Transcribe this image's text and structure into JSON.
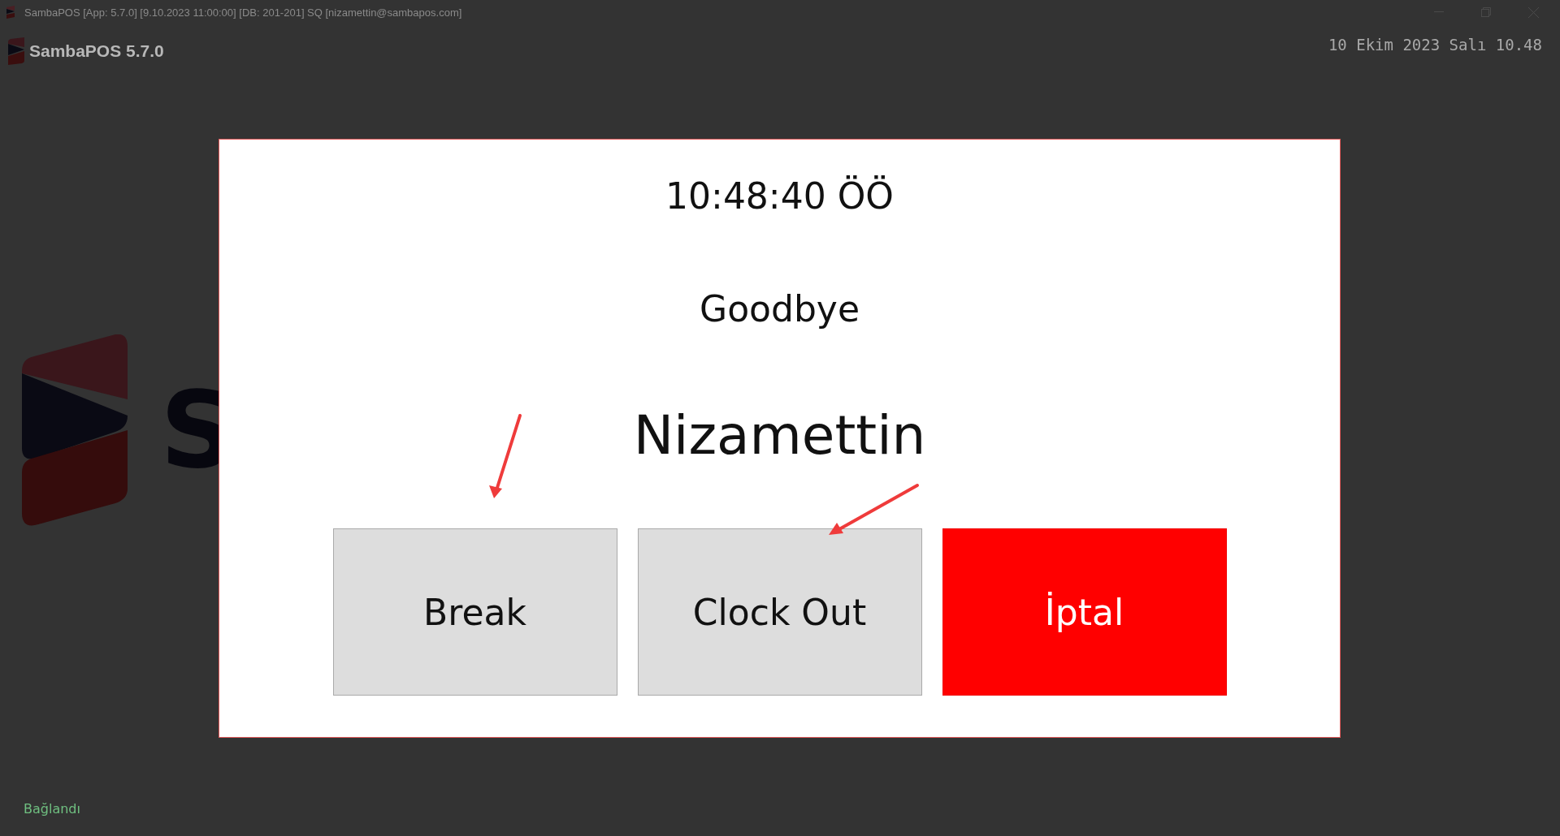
{
  "window": {
    "title": "SambaPOS [App: 5.7.0] [9.10.2023 11:00:00] [DB: 201-201] SQ [nizamettin@sambapos.com]"
  },
  "header": {
    "app_name": "SambaPOS 5.7.0",
    "datetime": "10 Ekim 2023 Salı 10.48"
  },
  "background_logo": {
    "letter": "S"
  },
  "dialog": {
    "time": "10:48:40 ÖÖ",
    "message": "Goodbye",
    "user_name": "Nizamettin",
    "buttons": [
      {
        "label": "Break",
        "kind": "default"
      },
      {
        "label": "Clock Out",
        "kind": "default"
      },
      {
        "label": "İptal",
        "kind": "cancel"
      }
    ]
  },
  "status_bar": {
    "text": "Bağlandı"
  }
}
